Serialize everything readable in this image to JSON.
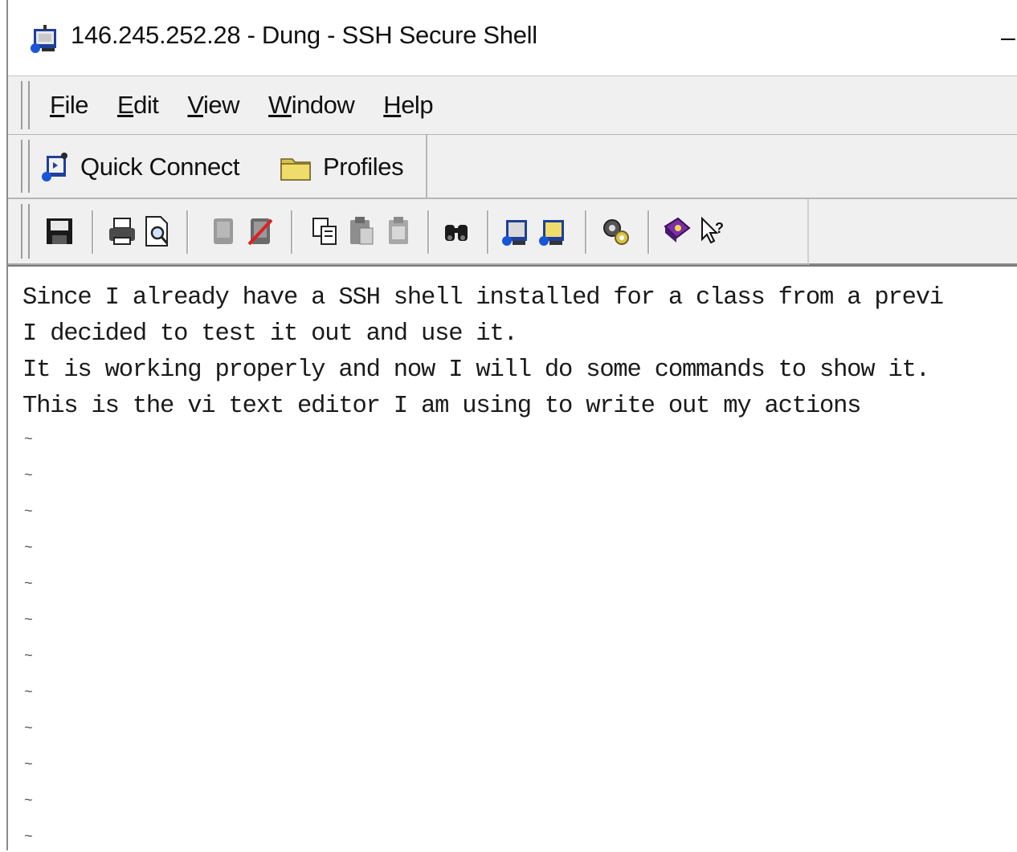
{
  "window": {
    "title": "146.245.252.28 - Dung - SSH Secure Shell",
    "minimize_glyph": "–"
  },
  "menu": {
    "items": [
      {
        "underline": "F",
        "rest": "ile"
      },
      {
        "underline": "E",
        "rest": "dit"
      },
      {
        "underline": "V",
        "rest": "iew"
      },
      {
        "underline": "W",
        "rest": "indow"
      },
      {
        "underline": "H",
        "rest": "elp"
      }
    ]
  },
  "connectbar": {
    "quick_connect_label": "Quick Connect",
    "profiles_label": "Profiles"
  },
  "toolbar": {
    "icons": [
      "save-icon",
      "print-icon",
      "print-preview-icon",
      "connect-icon",
      "disconnect-icon",
      "copy-icon",
      "paste-icon",
      "paste-disabled-icon",
      "find-icon",
      "new-terminal-icon",
      "new-file-transfer-icon",
      "settings-icon",
      "help-book-icon",
      "whats-this-help-icon"
    ]
  },
  "terminal": {
    "lines": [
      "Since I already have a SSH shell installed for a class from a previ",
      "I decided to test it out and use it.",
      "It is working properly and now I will do some commands to show it.",
      "This is the vi text editor I am using to write out my actions"
    ],
    "tilde_char": "~",
    "tilde_count": 12
  }
}
